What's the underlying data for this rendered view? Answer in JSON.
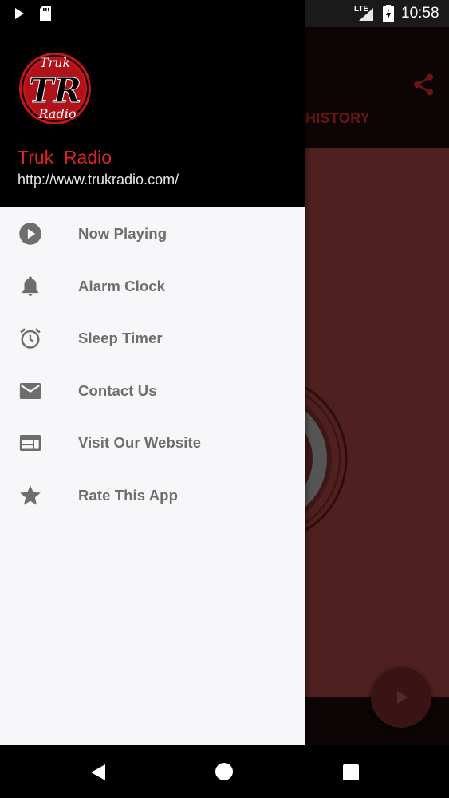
{
  "status_bar": {
    "time": "10:58",
    "network": "LTE",
    "icons": [
      "play-icon",
      "sd-card-icon",
      "signal-icon",
      "battery-charging-icon"
    ]
  },
  "background_app": {
    "tab_label": "NG HISTORY",
    "icons": [
      "share-icon",
      "play-fab-icon"
    ],
    "accent_color": "#4f2020"
  },
  "drawer": {
    "logo": {
      "top_text": "Truk",
      "center_text": "TR",
      "bottom_text": "Radio"
    },
    "station_name": "Truk  Radio",
    "station_url": "http://www.trukradio.com/",
    "items": [
      {
        "label": "Now Playing",
        "icon": "play-circle-icon"
      },
      {
        "label": "Alarm Clock",
        "icon": "bell-icon"
      },
      {
        "label": "Sleep Timer",
        "icon": "alarm-clock-icon"
      },
      {
        "label": "Contact Us",
        "icon": "mail-icon"
      },
      {
        "label": "Visit Our Website",
        "icon": "web-icon"
      },
      {
        "label": "Rate This App",
        "icon": "star-icon"
      }
    ]
  },
  "nav_bar": {
    "icons": [
      "back-icon",
      "home-icon",
      "recents-icon"
    ]
  },
  "colors": {
    "brand_red": "#e0232a",
    "drawer_bg": "#f7f6f9",
    "menu_text": "#6e6e6e"
  }
}
